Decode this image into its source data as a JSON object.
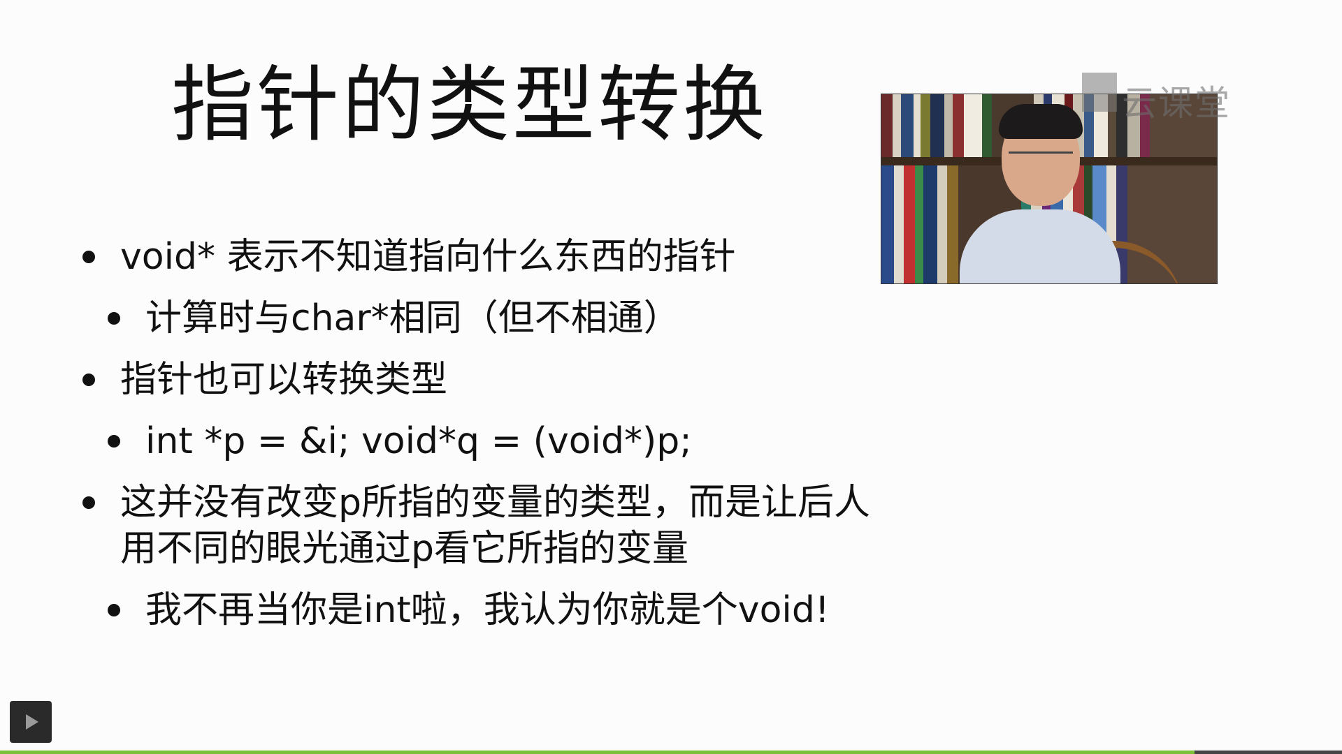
{
  "slide": {
    "title": "指针的类型转换",
    "bullets": [
      {
        "level": 1,
        "text": "void* 表示不知道指向什么东西的指针"
      },
      {
        "level": 2,
        "text": "计算时与char*相同（但不相通）"
      },
      {
        "level": 1,
        "text": "指针也可以转换类型"
      },
      {
        "level": 2,
        "text": "int *p = &i; void*q = (void*)p;"
      },
      {
        "level": 1,
        "text": "这并没有改变p所指的变量的类型，而是让后人用不同的眼光通过p看它所指的变量"
      },
      {
        "level": 2,
        "text": "我不再当你是int啦，我认为你就是个void!"
      }
    ]
  },
  "brand": {
    "name": "云课堂"
  },
  "player": {
    "play_icon": "play-icon",
    "progress": 0.89,
    "progress_color": "#7cc03a"
  },
  "colors": {
    "background": "#fcfcfc",
    "text": "#111111"
  }
}
